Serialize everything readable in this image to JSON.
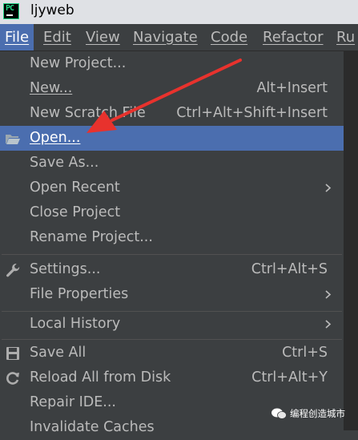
{
  "window": {
    "title": "ljyweb"
  },
  "menubar": {
    "items": [
      {
        "label": "File"
      },
      {
        "label": "Edit"
      },
      {
        "label": "View"
      },
      {
        "label": "Navigate"
      },
      {
        "label": "Code"
      },
      {
        "label": "Refactor"
      },
      {
        "label": "Ru"
      }
    ]
  },
  "file_menu": {
    "items": [
      {
        "label": "New Project...",
        "shortcut": ""
      },
      {
        "label": "New...",
        "shortcut": "Alt+Insert"
      },
      {
        "label": "New Scratch File",
        "shortcut": "Ctrl+Alt+Shift+Insert"
      },
      {
        "label": "Open...",
        "shortcut": "",
        "selected": true
      },
      {
        "label": "Save As...",
        "shortcut": ""
      },
      {
        "label": "Open Recent",
        "shortcut": "",
        "submenu": true
      },
      {
        "label": "Close Project",
        "shortcut": ""
      },
      {
        "label": "Rename Project...",
        "shortcut": ""
      },
      {
        "label": "Settings...",
        "shortcut": "Ctrl+Alt+S"
      },
      {
        "label": "File Properties",
        "shortcut": "",
        "submenu": true
      },
      {
        "label": "Local History",
        "shortcut": "",
        "submenu": true
      },
      {
        "label": "Save All",
        "shortcut": "Ctrl+S"
      },
      {
        "label": "Reload All from Disk",
        "shortcut": "Ctrl+Alt+Y"
      },
      {
        "label": "Repair IDE...",
        "shortcut": ""
      },
      {
        "label": "Invalidate Caches",
        "shortcut": ""
      }
    ]
  },
  "icons": {
    "app": "pycharm-logo-icon",
    "open": "folder-open-icon",
    "settings": "wrench-icon",
    "save_all": "save-icon",
    "reload": "reload-icon",
    "submenu": "chevron-right-icon"
  },
  "colors": {
    "menu_bg": "#3c3f41",
    "selection": "#4b6eaf",
    "text": "#bbbbbb",
    "annotation_arrow": "#e8322d"
  },
  "watermark": {
    "text": "编程创造城市"
  }
}
